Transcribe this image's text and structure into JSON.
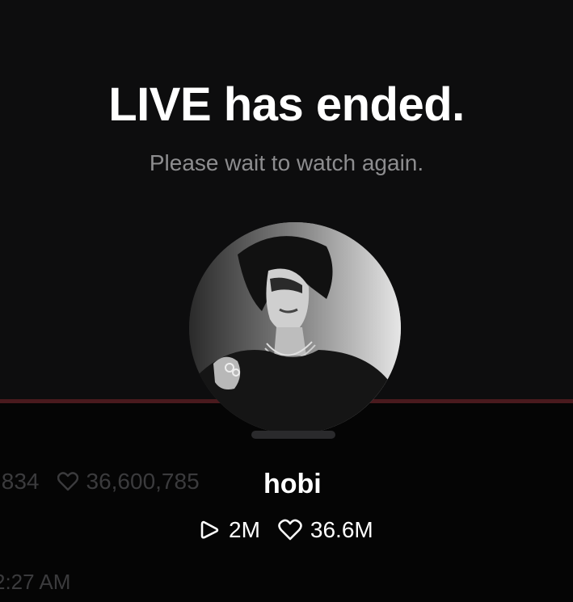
{
  "live_status": {
    "title": "LIVE has ended.",
    "subtitle": "Please wait to watch again."
  },
  "profile": {
    "username": "hobi",
    "views": "2M",
    "likes": "36.6M"
  },
  "background_stats": {
    "views_partial": ",834",
    "likes": "36,600,785",
    "time_partial": "2:27 AM"
  },
  "icons": {
    "views": "play-icon",
    "likes": "heart-icon"
  },
  "colors": {
    "background": "#0d0d0e",
    "progress_line": "#4a1a1e",
    "subtitle_text": "#8d8d8f",
    "ghost_text": "#3b3b3d"
  }
}
